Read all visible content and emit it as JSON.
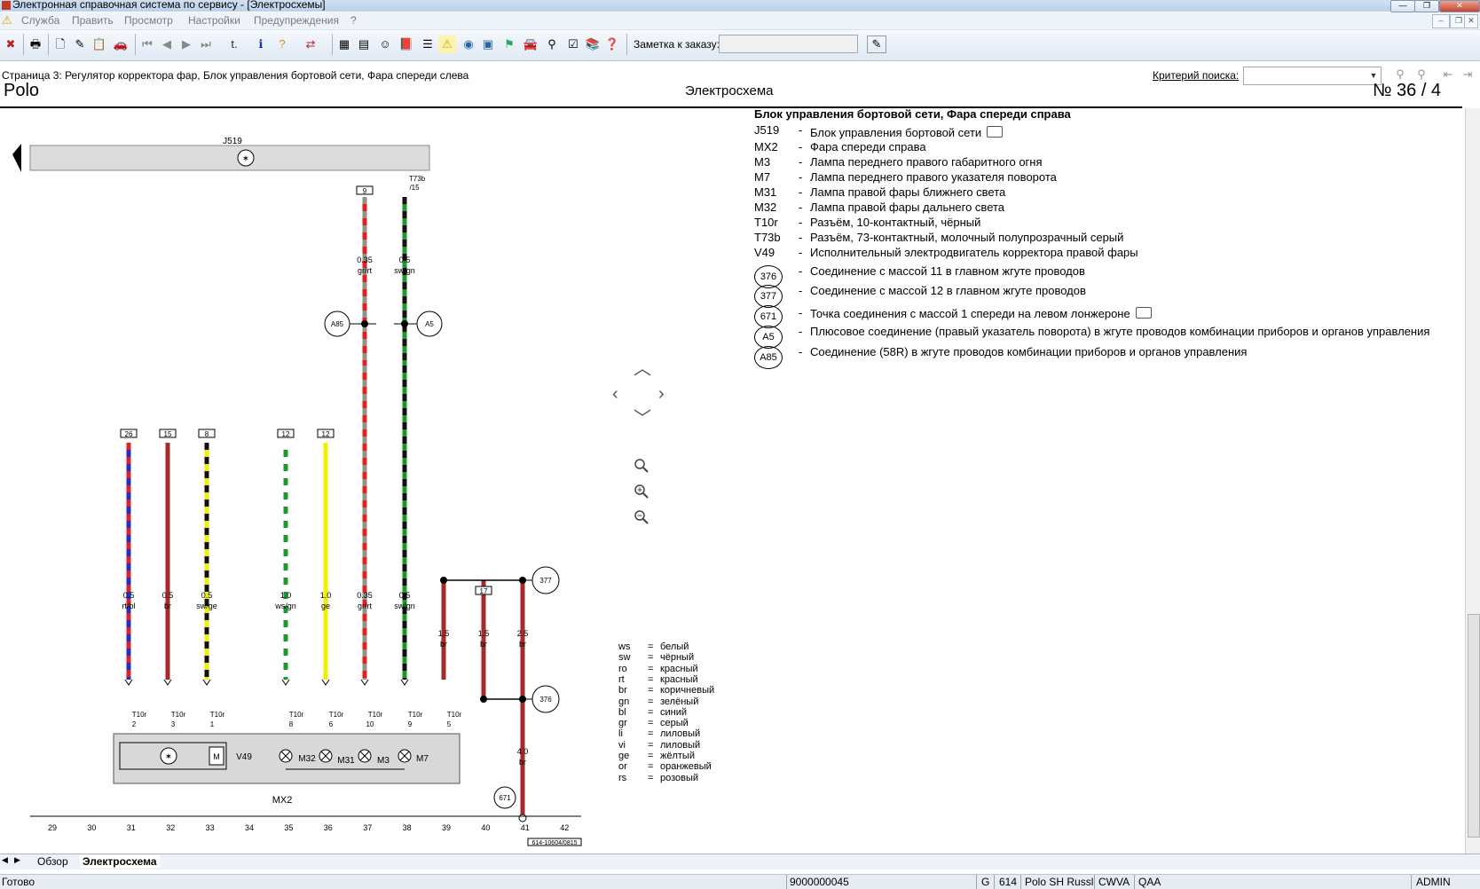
{
  "window": {
    "title": "Электронная справочная система по сервису - [Электросхемы]"
  },
  "menu": [
    "Служба",
    "Править",
    "Просмотр",
    "Настройки",
    "Предупреждения",
    "?"
  ],
  "toolbar": {
    "note_label": "Заметка к заказу:",
    "note_value": ""
  },
  "page": {
    "description": "Страница 3: Регулятор корректора фар, Блок управления бортовой сети, Фара спереди слева",
    "search_label": "Критерий поиска:",
    "search_value": ""
  },
  "doc": {
    "model": "Polo",
    "type": "Электросхема",
    "number": "№  36 / 4"
  },
  "legend": {
    "title": "Блок управления бортовой сети, Фара спереди справа",
    "items": [
      {
        "code": "J519",
        "desc": "Блок управления бортовой сети"
      },
      {
        "code": "MX2",
        "desc": "Фара спереди справа"
      },
      {
        "code": "M3",
        "desc": "Лампа переднего правого габаритного огня"
      },
      {
        "code": "M7",
        "desc": "Лампа переднего правого указателя поворота"
      },
      {
        "code": "M31",
        "desc": "Лампа правой фары ближнего света"
      },
      {
        "code": "M32",
        "desc": "Лампа правой фары дальнего света"
      },
      {
        "code": "T10r",
        "desc": "Разъём, 10-контактный, чёрный"
      },
      {
        "code": "T73b",
        "desc": "Разъём, 73-контактный, молочный полупрозрачный серый"
      },
      {
        "code": "V49",
        "desc": "Исполнительный электродвигатель корректора правой фары"
      }
    ],
    "circles": [
      {
        "code": "376",
        "desc": "Соединение с массой 11 в главном жгуте проводов"
      },
      {
        "code": "377",
        "desc": "Соединение с массой 12 в главном жгуте проводов"
      },
      {
        "code": "671",
        "desc": "Точка соединения с массой 1 спереди на левом лонжероне"
      },
      {
        "code": "A5",
        "desc": "Плюсовое соединение (правый указатель поворота) в жгуте проводов комбинации приборов и органов управления"
      },
      {
        "code": "A85",
        "desc": "Соединение (58R) в жгуте проводов комбинации приборов и органов управления"
      }
    ]
  },
  "color_codes": [
    {
      "abbr": "ws",
      "name": "белый"
    },
    {
      "abbr": "sw",
      "name": "чёрный"
    },
    {
      "abbr": "ro",
      "name": "красный"
    },
    {
      "abbr": "rt",
      "name": "красный"
    },
    {
      "abbr": "br",
      "name": "коричневый"
    },
    {
      "abbr": "gn",
      "name": "зелёный"
    },
    {
      "abbr": "bl",
      "name": "синий"
    },
    {
      "abbr": "gr",
      "name": "серый"
    },
    {
      "abbr": "li",
      "name": "лиловый"
    },
    {
      "abbr": "vi",
      "name": "лиловый"
    },
    {
      "abbr": "ge",
      "name": "жёлтый"
    },
    {
      "abbr": "or",
      "name": "оранжевый"
    },
    {
      "abbr": "rs",
      "name": "розовый"
    }
  ],
  "schematic": {
    "j519_label": "J519",
    "t73b_label": "T73b",
    "t73b_pin": "/15",
    "mx2_label": "MX2",
    "doc_code": "614-10604/0815",
    "v49_label": "V49",
    "m32_label": "M32",
    "m31_label": "M31",
    "m3_label": "M3",
    "m7_label": "M7",
    "a85": "A85",
    "a5": "A5",
    "g377": "377",
    "g376": "376",
    "g671": "671",
    "top_wires": [
      {
        "pin": "9",
        "size": "0.35",
        "color": "gr/rt"
      },
      {
        "pin": "",
        "size": "0.5",
        "color": "sw/gn"
      }
    ],
    "wires": [
      {
        "pin": "26",
        "size": "0.5",
        "color": "rt/bl",
        "conn": "T10r",
        "cpin": "2"
      },
      {
        "pin": "15",
        "size": "0.5",
        "color": "br",
        "conn": "T10r",
        "cpin": "3"
      },
      {
        "pin": "8",
        "size": "0.5",
        "color": "sw/ge",
        "conn": "T10r",
        "cpin": "1"
      },
      {
        "pin": "12",
        "size": "1.0",
        "color": "ws/gn",
        "conn": "T10r",
        "cpin": "8"
      },
      {
        "pin": "12",
        "size": "1.0",
        "color": "ge",
        "conn": "T10r",
        "cpin": "6"
      },
      {
        "pin": "",
        "size": "0.35",
        "color": "gr/rt",
        "conn": "T10r",
        "cpin": "10"
      },
      {
        "pin": "",
        "size": "0.5",
        "color": "sw/gn",
        "conn": "T10r",
        "cpin": "9"
      }
    ],
    "ground_wires": [
      {
        "size": "1.5",
        "color": "br",
        "conn": "T10r",
        "cpin": "5"
      },
      {
        "pin": "17",
        "size": "1.5",
        "color": "br"
      },
      {
        "size": "2.5",
        "color": "br"
      },
      {
        "size": "4.0",
        "color": "br"
      }
    ],
    "track_numbers": [
      "29",
      "30",
      "31",
      "32",
      "33",
      "34",
      "35",
      "36",
      "37",
      "38",
      "39",
      "40",
      "41",
      "42"
    ]
  },
  "tabs": [
    "Обзор",
    "Электросхема"
  ],
  "status": {
    "ready": "Готово",
    "code": "9000000045",
    "g": "G",
    "num": "614",
    "model": "Polo SH Russl",
    "engine": "CWVA",
    "gear": "QAA",
    "user": "ADMIN"
  }
}
